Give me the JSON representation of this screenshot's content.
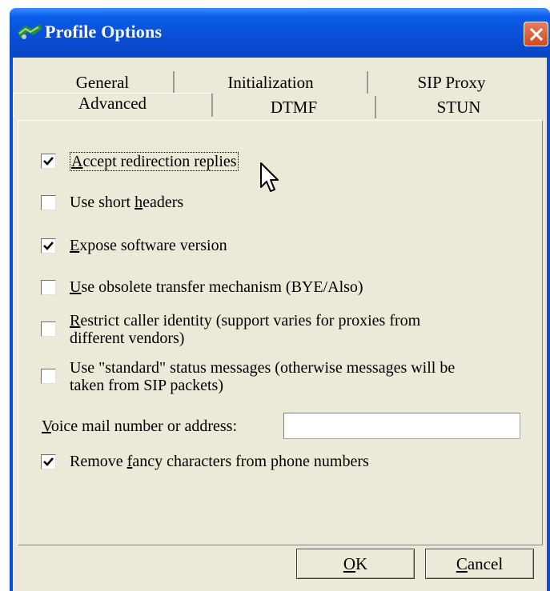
{
  "window": {
    "title": "Profile Options"
  },
  "tabs": {
    "row1": [
      "General",
      "Initialization",
      "SIP Proxy"
    ],
    "row2": [
      "Advanced",
      "DTMF",
      "STUN"
    ],
    "active": "Advanced"
  },
  "options": [
    {
      "pre": "",
      "u": "A",
      "post": "ccept redirection replies",
      "line2": "",
      "checked": true
    },
    {
      "pre": "Use short ",
      "u": "h",
      "post": "eaders",
      "line2": "",
      "checked": false
    },
    {
      "pre": "",
      "u": "E",
      "post": "xpose software version",
      "line2": "",
      "checked": true
    },
    {
      "pre": "",
      "u": "U",
      "post": "se obsolete transfer mechanism (BYE/Also)",
      "line2": "",
      "checked": false
    },
    {
      "pre": "",
      "u": "R",
      "post": "estrict caller identity (support varies for proxies from",
      "line2": "different vendors)",
      "checked": false
    },
    {
      "pre": "Use \"standard\" status messages (otherwise messages will be",
      "u": "",
      "post": "",
      "line2": "taken from SIP packets)",
      "checked": false
    }
  ],
  "voicemail": {
    "label_u": "V",
    "label_rest": "oice mail number or address:",
    "value": ""
  },
  "fancy": {
    "pre": "Remove ",
    "u": "f",
    "post": "ancy characters from phone numbers",
    "checked": true
  },
  "buttons": {
    "ok_u": "O",
    "ok_rest": "K",
    "cancel_u": "C",
    "cancel_rest": "ancel"
  }
}
